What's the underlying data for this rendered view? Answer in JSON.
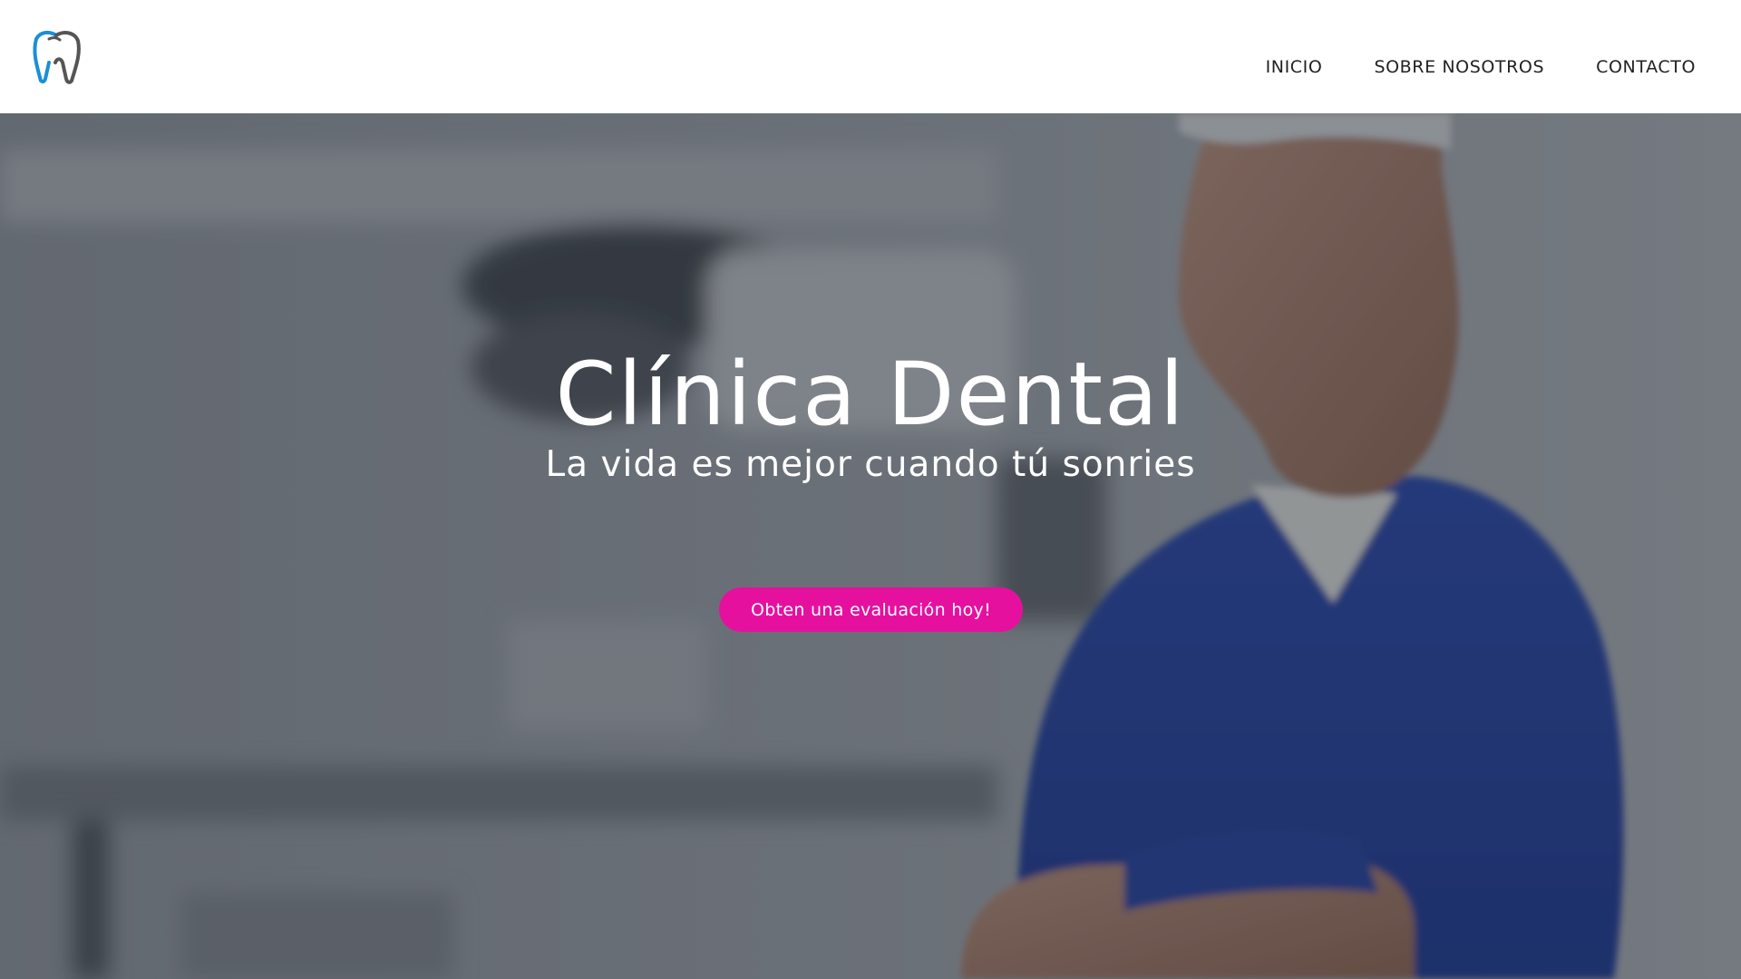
{
  "header": {
    "logo_icon": "tooth-icon",
    "logo_colors": {
      "primary": "#1a8fd6",
      "secondary": "#555555"
    },
    "nav": [
      {
        "label": "INICIO"
      },
      {
        "label": "SOBRE NOSOTROS"
      },
      {
        "label": "CONTACTO"
      }
    ]
  },
  "hero": {
    "background_image": "dentist-in-blue-scrubs-photo",
    "title": "Clínica Dental",
    "subtitle": "La vida es mejor cuando tú sonries",
    "cta_label": "Obten una evaluación hoy!",
    "cta_color": "#e6109f"
  }
}
